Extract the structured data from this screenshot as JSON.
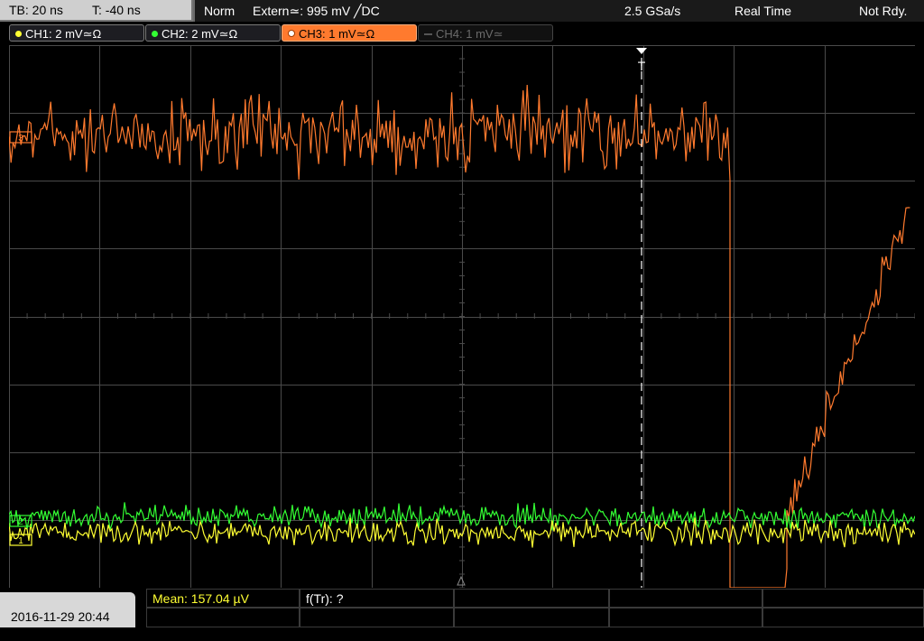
{
  "toolbar": {
    "timebase": "TB: 20 ns",
    "trigger_time": "T: -40 ns",
    "mode": "Norm",
    "trigger_source": "Extern≃: 995 mV ╱DC",
    "sample_rate": "2.5 GSa/s",
    "acquisition": "Real Time",
    "status": "Not Rdy."
  },
  "channels": [
    {
      "label": "CH1: 2 mV≃Ω",
      "color": "#ffff33",
      "state": "on"
    },
    {
      "label": "CH2: 2 mV≃Ω",
      "color": "#33ff33",
      "state": "on"
    },
    {
      "label": "CH3: 1 mV≃Ω",
      "color": "#ff7a2e",
      "state": "active"
    },
    {
      "label": "CH4: 1 mV≃",
      "color": "#666666",
      "state": "off"
    }
  ],
  "markers": {
    "trigger": "T",
    "ch3": "3",
    "ch2": "2",
    "ch1": "1"
  },
  "footer": {
    "datetime": "2016-11-29 20:44",
    "mean": "Mean: 157.04 µV",
    "freq": "f(Tr): ?"
  },
  "colors": {
    "ch1": "#ffff33",
    "ch2": "#33ff33",
    "ch3": "#ff7a2e",
    "grid": "#4a4a4a"
  }
}
